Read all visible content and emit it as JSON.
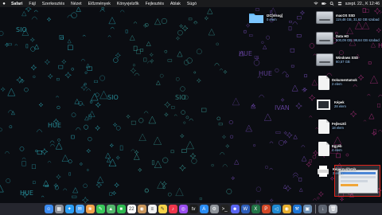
{
  "menubar": {
    "apple_icon": "apple-icon",
    "items": [
      "Safari",
      "Fájl",
      "Szerkesztés",
      "Nézet",
      "Előzmények",
      "Könyvjelzők",
      "Fejlesztés",
      "Ablak",
      "Súgó"
    ],
    "clock": "szept. 22., K 12:46"
  },
  "desktop": {
    "folder": {
      "name": "I2C[vlsog]",
      "count": "0 elem"
    },
    "drives": [
      {
        "name": "macOS SSD",
        "detail": "119,48 GB, 31,62 GB szabad"
      },
      {
        "name": "Data HD",
        "detail": "500,09 GB, 99,64 GB szabad"
      },
      {
        "name": "Windows SSD",
        "detail": "60,57 GB"
      }
    ],
    "docs": [
      {
        "name": "Dokumentumok",
        "count": "2 elem"
      },
      {
        "name": "Képek",
        "count": "28 elem"
      },
      {
        "name": "Fejlesztő",
        "count": "18 elem"
      },
      {
        "name": "Egyéb",
        "count": "4 elem"
      }
    ],
    "screenshots": {
      "name": "Képernyőfotók",
      "count": "2 elem"
    }
  },
  "wallpaper_text": [
    "SIO",
    "SIO",
    "SIO",
    "HUE",
    "HUE",
    "HUE",
    "HUE",
    "IVAN",
    "HUE"
  ],
  "dock": {
    "apps": [
      {
        "name": "finder-icon",
        "glyph": "☺",
        "color": "#3b8bf0"
      },
      {
        "name": "launchpad-icon",
        "glyph": "▦",
        "color": "#8a8f99"
      },
      {
        "name": "safari-icon",
        "glyph": "✦",
        "color": "#2a9df4"
      },
      {
        "name": "mail-icon",
        "glyph": "✉",
        "color": "#4aa3f6"
      },
      {
        "name": "photos-icon",
        "glyph": "❀",
        "color": "#f2a24a"
      },
      {
        "name": "messages-icon",
        "glyph": "✎",
        "color": "#38c759"
      },
      {
        "name": "maps-icon",
        "glyph": "▲",
        "color": "#53b66b"
      },
      {
        "name": "facetime-icon",
        "glyph": "■",
        "color": "#2fb84f"
      },
      {
        "name": "calendar-icon",
        "glyph": "22",
        "color": "#ffffff"
      },
      {
        "name": "contacts-icon",
        "glyph": "◉",
        "color": "#c8955b"
      },
      {
        "name": "reminders-icon",
        "glyph": "≡",
        "color": "#f1f1f1"
      },
      {
        "name": "notes-icon",
        "glyph": "✎",
        "color": "#f7d34a"
      },
      {
        "name": "music-icon",
        "glyph": "♪",
        "color": "#f0364b"
      },
      {
        "name": "podcasts-icon",
        "glyph": "◎",
        "color": "#9b4ef0"
      },
      {
        "name": "tv-icon",
        "glyph": "tv",
        "color": "#1b1b1b"
      },
      {
        "name": "appstore-icon",
        "glyph": "A",
        "color": "#2a8cf4"
      },
      {
        "name": "settings-icon",
        "glyph": "⚙",
        "color": "#8f949b"
      },
      {
        "name": "terminal-icon",
        "glyph": ">_",
        "color": "#222222"
      },
      {
        "name": "discord-icon",
        "glyph": "☻",
        "color": "#5865f2"
      },
      {
        "name": "word-icon",
        "glyph": "W",
        "color": "#2b5cb8"
      },
      {
        "name": "excel-icon",
        "glyph": "X",
        "color": "#217346"
      },
      {
        "name": "powerpoint-icon",
        "glyph": "P",
        "color": "#d24726"
      },
      {
        "name": "vscode-icon",
        "glyph": "◁",
        "color": "#1f8ad2"
      },
      {
        "name": "chrome-icon",
        "glyph": "◉",
        "color": "#e8b031"
      },
      {
        "name": "xcode-icon",
        "glyph": "⚒",
        "color": "#1c75d6"
      },
      {
        "name": "preview-icon",
        "glyph": "▣",
        "color": "#6d8fb3"
      }
    ],
    "trailing": [
      {
        "name": "downloads-icon",
        "glyph": "↓",
        "color": "#5d6470"
      },
      {
        "name": "trash-icon",
        "glyph": "🗑",
        "color": "#b7bcc4"
      }
    ]
  }
}
